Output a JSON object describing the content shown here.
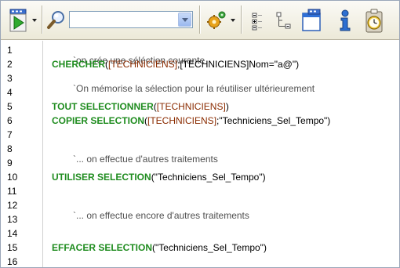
{
  "toolbar": {
    "combo_value": "",
    "icons": [
      "run-icon",
      "search-icon",
      "code-nav-icon",
      "structure-icon",
      "window-icon",
      "info-icon",
      "clipboard-clock-icon"
    ]
  },
  "editor": {
    "line_numbers": [
      "1",
      "2",
      "3",
      "4",
      "5",
      "6",
      "7",
      "8",
      "9",
      "10",
      "11",
      "12",
      "13",
      "14",
      "15",
      "16"
    ],
    "lines": {
      "l1": {
        "text": "`on crée une séléction courante"
      },
      "l2": {
        "cmd": "CHERCHER",
        "p1": "(",
        "tab1": "[TECHNICIENS]",
        "p2": ";",
        "tab2": "[TECHNICIENS]",
        "rest": "Nom=\"a@\")"
      },
      "l3": {
        "text": "`On mémorise la sélection pour la réutiliser ultérieurement"
      },
      "l5": {
        "cmd": "TOUT SELECTIONNER",
        "p1": "(",
        "tab1": "[TECHNICIENS]",
        "rest": ")"
      },
      "l6": {
        "cmd": "COPIER SELECTION",
        "p1": "(",
        "tab1": "[TECHNICIENS]",
        "rest": ";\"Techniciens_Sel_Tempo\")"
      },
      "l8": {
        "text": "`... on effectue d'autres traitements"
      },
      "l10": {
        "cmd": "UTILISER SELECTION",
        "rest": "(\"Techniciens_Sel_Tempo\")"
      },
      "l12": {
        "text": "`... on effectue encore d'autres traitements"
      },
      "l15": {
        "cmd": "EFFACER SELECTION",
        "rest": "(\"Techniciens_Sel_Tempo\")"
      }
    }
  },
  "colors": {
    "command": "#1f8c1f",
    "table": "#8a2b00",
    "comment": "#505050"
  }
}
